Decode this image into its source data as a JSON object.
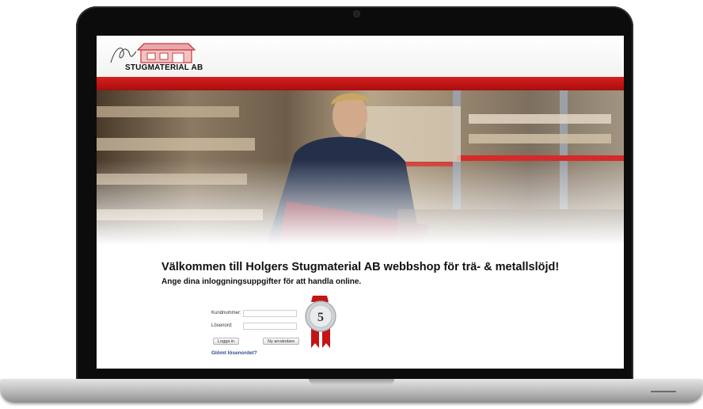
{
  "site": {
    "brand_name": "STUGMATERIAL AB",
    "welcome_heading": "Välkommen till Holgers Stugmaterial AB webbshop för trä- & metallslöjd!",
    "subtitle": "Ange dina inloggningsuppgifter för att handla online."
  },
  "login_form": {
    "customer_number_label": "Kundnummer:",
    "customer_number_value": "",
    "password_label": "Lösenord:",
    "password_value": "",
    "login_button": "Logga in",
    "new_user_button": "Ny användare",
    "forgot_password_link": "Glömt lösenordet?"
  },
  "badge": {
    "number": "5"
  },
  "colors": {
    "red_band": "#c41414",
    "link_blue": "#2b4f8c",
    "laptop_bezel": "#0c0c0c"
  }
}
